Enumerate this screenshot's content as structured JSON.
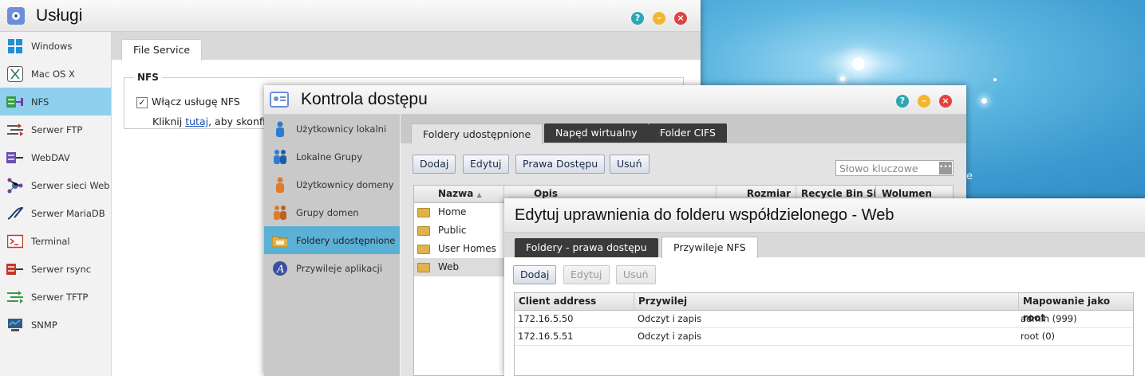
{
  "services_window": {
    "title": "Usługi",
    "sidebar": [
      {
        "label": "Windows",
        "icon": "windows-icon"
      },
      {
        "label": "Mac OS X",
        "icon": "mac-icon"
      },
      {
        "label": "NFS",
        "icon": "nfs-icon",
        "active": true
      },
      {
        "label": "Serwer FTP",
        "icon": "ftp-icon"
      },
      {
        "label": "WebDAV",
        "icon": "webdav-icon"
      },
      {
        "label": "Serwer sieci Web",
        "icon": "web-server-icon"
      },
      {
        "label": "Serwer MariaDB",
        "icon": "mariadb-icon"
      },
      {
        "label": "Terminal",
        "icon": "terminal-icon"
      },
      {
        "label": "Serwer rsync",
        "icon": "rsync-icon"
      },
      {
        "label": "Serwer TFTP",
        "icon": "tftp-icon"
      },
      {
        "label": "SNMP",
        "icon": "snmp-icon"
      }
    ],
    "tab": "File Service",
    "fieldset_legend": "NFS",
    "enable_nfs_label": "Włącz usługę NFS",
    "enable_nfs_checked": true,
    "hint_prefix": "Kliknij ",
    "hint_link": "tutaj",
    "hint_suffix": ", aby skonfi"
  },
  "access_window": {
    "title": "Kontrola dostępu",
    "sidebar": [
      {
        "label": "Użytkownicy lokalni",
        "icon": "local-user-icon"
      },
      {
        "label": "Lokalne Grupy",
        "icon": "local-group-icon"
      },
      {
        "label": "Użytkownicy domeny",
        "icon": "domain-user-icon"
      },
      {
        "label": "Grupy domen",
        "icon": "domain-group-icon"
      },
      {
        "label": "Foldery udostępnione",
        "icon": "shared-folder-icon",
        "active": true
      },
      {
        "label": "Przywileje aplikacji",
        "icon": "app-privilege-icon"
      }
    ],
    "tabs": [
      "Foldery udostępnione",
      "Napęd wirtualny",
      "Folder CIFS"
    ],
    "buttons": {
      "add": "Dodaj",
      "edit": "Edytuj",
      "access": "Prawa Dostępu",
      "delete": "Usuń"
    },
    "search_placeholder": "Słowo kluczowe",
    "columns": [
      "Nazwa",
      "Opis",
      "Rozmiar",
      "Recycle Bin Siz",
      "Wolumen"
    ],
    "rows": [
      "Home",
      "Public",
      "User Homes",
      "Web"
    ],
    "selected_row": "Web"
  },
  "edit_dialog": {
    "title": "Edytuj uprawnienia do folderu współdzielonego - Web",
    "tabs": [
      "Foldery - prawa dostępu",
      "Przywileje NFS"
    ],
    "buttons": {
      "add": "Dodaj",
      "edit": "Edytuj",
      "delete": "Usuń"
    },
    "columns": [
      "Client address",
      "Przywilej",
      "Mapowanie jako root"
    ],
    "rows": [
      {
        "client": "172.16.5.50",
        "privilege": "Odczyt i zapis",
        "root_map": "admin (999)"
      },
      {
        "client": "172.16.5.51",
        "privilege": "Odczyt i zapis",
        "root_map": "root (0)"
      }
    ]
  },
  "desktop_fragment": "e"
}
